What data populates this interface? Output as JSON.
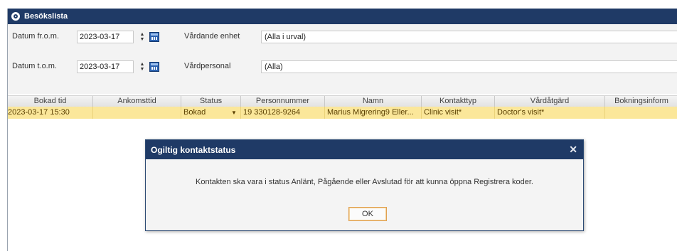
{
  "window": {
    "title": "Besökslista"
  },
  "filters": {
    "date_from_label": "Datum fr.o.m.",
    "date_from_value": "2023-03-17",
    "date_to_label": "Datum t.o.m.",
    "date_to_value": "2023-03-17",
    "unit_label": "Vårdande enhet",
    "unit_value": "(Alla i urval)",
    "staff_label": "Vårdpersonal",
    "staff_value": "(Alla)"
  },
  "table": {
    "headers": [
      "Bokad tid",
      "Ankomsttid",
      "Status",
      "Personnummer",
      "Namn",
      "Kontakttyp",
      "Vårdåtgärd",
      "Bokningsinform"
    ],
    "rows": [
      {
        "booked": "2023-03-17 15:30",
        "arrival": "",
        "status": "Bokad",
        "pnr": "19 330128-9264",
        "name": "Marius Migrering9 Eller...",
        "contact_type": "Clinic visit*",
        "care_action": "Doctor's visit*",
        "booking_info": ""
      }
    ]
  },
  "dialog": {
    "title": "Ogiltig kontaktstatus",
    "message": "Kontakten ska vara i status Anlänt, Pågående eller Avslutad för att kunna öppna Registrera koder.",
    "ok_label": "OK",
    "close_glyph": "✕"
  },
  "colors": {
    "titlebar": "#1f3a66",
    "selected_row": "#fbe79a",
    "ok_border": "#e0a050"
  }
}
